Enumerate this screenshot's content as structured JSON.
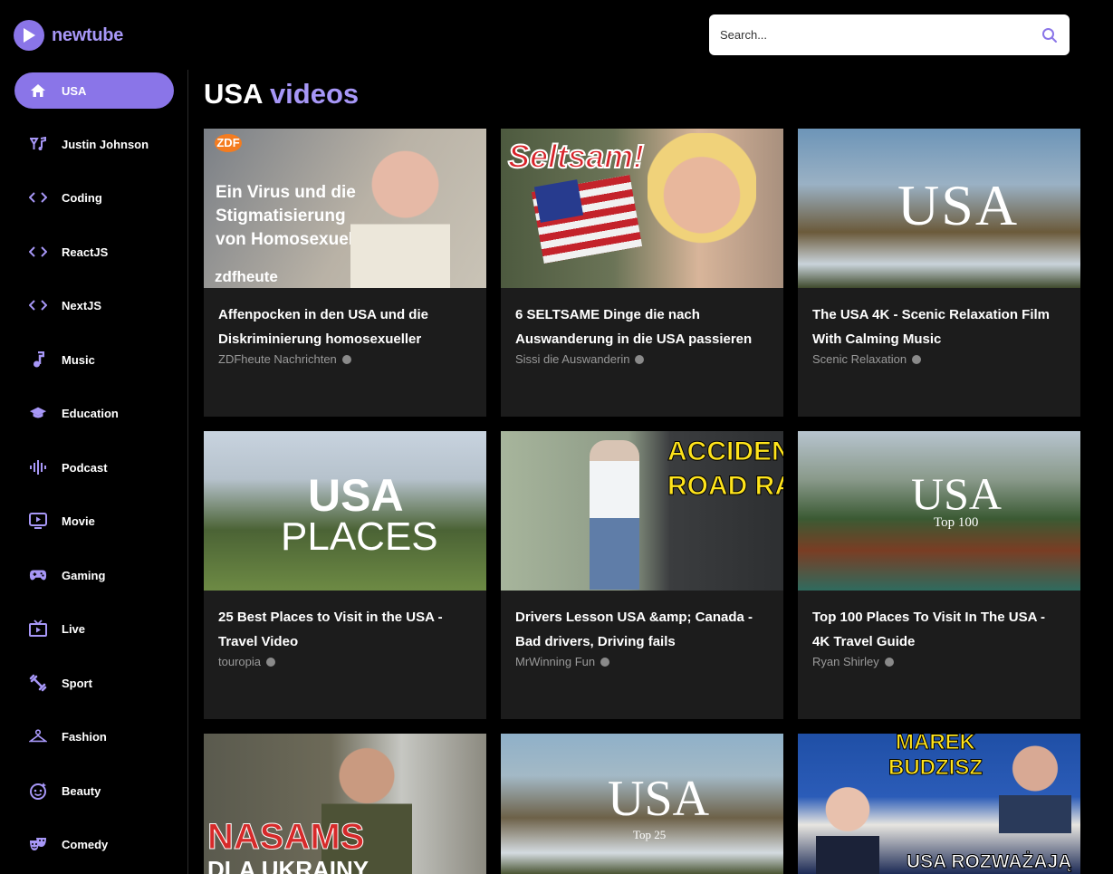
{
  "brand": {
    "name": "newtube",
    "accent": "#8a75e8"
  },
  "search": {
    "placeholder": "Search..."
  },
  "sidebar": {
    "items": [
      {
        "label": "USA",
        "icon": "home-icon",
        "active": true
      },
      {
        "label": "Justin Johnson",
        "icon": "music-note-icon"
      },
      {
        "label": "Coding",
        "icon": "code-icon"
      },
      {
        "label": "ReactJS",
        "icon": "code-icon"
      },
      {
        "label": "NextJS",
        "icon": "code-icon"
      },
      {
        "label": "Music",
        "icon": "music-icon"
      },
      {
        "label": "Education",
        "icon": "graduation-cap-icon"
      },
      {
        "label": "Podcast",
        "icon": "podcast-icon"
      },
      {
        "label": "Movie",
        "icon": "movie-icon"
      },
      {
        "label": "Gaming",
        "icon": "gamepad-icon"
      },
      {
        "label": "Live",
        "icon": "live-tv-icon"
      },
      {
        "label": "Sport",
        "icon": "fitness-icon"
      },
      {
        "label": "Fashion",
        "icon": "hanger-icon"
      },
      {
        "label": "Beauty",
        "icon": "face-icon"
      },
      {
        "label": "Comedy",
        "icon": "theater-masks-icon"
      }
    ]
  },
  "main": {
    "title_prefix": "USA",
    "title_accent": "videos",
    "videos": [
      {
        "title_line1": "Affenpocken in den USA und die",
        "title_line2": "Diskriminierung homosexueller",
        "channel": "ZDFheute Nachrichten",
        "thumb": {
          "bg": "linear-gradient(120deg,#7a7f86 0%,#b9b2a6 55%,#c9c3b6 100%)",
          "lines": [
            "Ein Virus und die",
            "Stigmatisierung",
            "von Homosexuellen"
          ],
          "brand": "zdfheute",
          "corner": "ZDF"
        }
      },
      {
        "title_line1": "6 SELTSAME Dinge die nach",
        "title_line2": "Auswanderung in die USA passieren",
        "channel": "Sissi die Auswanderin",
        "thumb": {
          "bg": "linear-gradient(90deg,#4d5a3f 0%,#6b7457 40%,#d8b59a 70%,#a8907e 100%)",
          "lines": [
            "Seltsam!"
          ]
        }
      },
      {
        "title_line1": "The USA 4K - Scenic Relaxation Film",
        "title_line2": "With Calming Music",
        "channel": "Scenic Relaxation",
        "thumb": {
          "bg": "linear-gradient(180deg,#6d95b8 0%,#9ab1c4 35%,#6b5a3a 65%,#c9d3da 85%,#3f4a2c 100%)",
          "lines": [
            "USA"
          ]
        }
      },
      {
        "title_line1": "25 Best Places to Visit in the USA -",
        "title_line2": "Travel Video",
        "channel": "touropia",
        "thumb": {
          "bg": "linear-gradient(180deg,#c8d3df 0%,#b6c2cc 30%,#4b6335 62%,#6d8a44 100%)",
          "lines": [
            "USA",
            "PLACES"
          ]
        }
      },
      {
        "title_line1": "Drivers Lesson USA &amp; Canada -",
        "title_line2": "Bad drivers, Driving fails",
        "channel": "MrWinning Fun",
        "thumb": {
          "bg": "linear-gradient(90deg,#a7b59c 0%,#8d9a86 45%,#3b3d3f 60%,#2d2f31 100%)",
          "lines": [
            "ACCIDEN",
            "ROAD RAG"
          ]
        }
      },
      {
        "title_line1": "Top 100 Places To Visit In The USA -",
        "title_line2": "4K Travel Guide",
        "channel": "Ryan Shirley",
        "thumb": {
          "bg": "linear-gradient(180deg,#b7c4cf 0%,#8a9a8b 30%,#3b5a33 55%,#7a3d24 75%,#2f6b5e 100%)",
          "lines": [
            "USA",
            "Top 100"
          ]
        }
      },
      {
        "title_line1": "",
        "title_line2": "",
        "channel": "",
        "thumb": {
          "bg": "linear-gradient(90deg,#5a5a4e 0%,#6d6a58 45%,#c6c7c2 70%,#8c8a80 100%)",
          "lines": [
            "NASAMS",
            "DLA UKRAINY"
          ]
        }
      },
      {
        "title_line1": "",
        "title_line2": "",
        "channel": "",
        "thumb": {
          "bg": "linear-gradient(180deg,#8fb0c8 0%,#a3b9c6 30%,#6d6148 60%,#d4dbe0 85%,#4a5533 100%)",
          "lines": [
            "USA",
            "Top 25"
          ]
        }
      },
      {
        "title_line1": "",
        "title_line2": "",
        "channel": "",
        "thumb": {
          "bg": "linear-gradient(180deg,#1f4fa6 0%,#2b5cb8 45%,#e7e5e0 65%,#1c2a55 100%)",
          "lines": [
            "MAREK",
            "BUDZISZ",
            "USA ROZWAŻAJĄ"
          ]
        }
      }
    ]
  }
}
